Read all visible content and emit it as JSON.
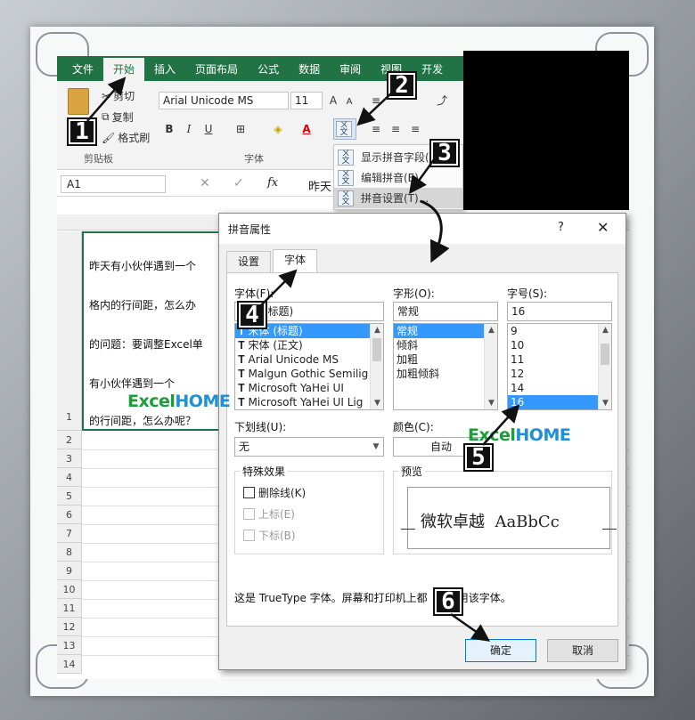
{
  "ribbon": {
    "tabs": [
      "文件",
      "开始",
      "插入",
      "页面布局",
      "公式",
      "数据",
      "审阅",
      "视图",
      "开发"
    ],
    "clipboard": {
      "cut": "剪切",
      "copy": "复制",
      "format_painter": "格式刷",
      "group": "剪贴板"
    },
    "font": {
      "name": "Arial Unicode MS",
      "size": "11",
      "group": "字体",
      "bold": "B",
      "italic": "I",
      "underline": "U",
      "grow": "A",
      "shrink": "A"
    }
  },
  "pinyin_menu": {
    "items": [
      "显示拼音字段(S)",
      "编辑拼音(E)",
      "拼音设置(T)..."
    ]
  },
  "formula_bar": {
    "name_box": "A1",
    "fx": "fx",
    "content": "昨天"
  },
  "sheet": {
    "rows": [
      "1",
      "2",
      "3",
      "4",
      "5",
      "6",
      "7",
      "8",
      "9",
      "10",
      "11",
      "12",
      "13",
      "14"
    ],
    "a1_lines": [
      "昨天有小伙伴遇到一个",
      "格内的行间距，怎么办",
      "的问题：要调整Excel单",
      "有小伙伴遇到一个",
      "的行间距，怎么办呢？"
    ]
  },
  "dialog": {
    "title": "拼音属性",
    "help": "?",
    "close": "✕",
    "tabs": [
      "设置",
      "字体"
    ],
    "font_label": "字体(F):",
    "font_value": "宋体 (标题)",
    "font_list": [
      "宋体 (标题)",
      "宋体 (正文)",
      "Arial Unicode MS",
      "Malgun Gothic Semilig",
      "Microsoft YaHei UI",
      "Microsoft YaHei UI Lig"
    ],
    "style_label": "字形(O):",
    "style_value": "常规",
    "style_list": [
      "常规",
      "倾斜",
      "加粗",
      "加粗倾斜"
    ],
    "size_label": "字号(S):",
    "size_value": "16",
    "size_list": [
      "9",
      "10",
      "11",
      "12",
      "14",
      "16"
    ],
    "underline_label": "下划线(U):",
    "underline_value": "无",
    "color_label": "颜色(C):",
    "color_value": "自动",
    "effects_label": "特殊效果",
    "strike": "删除线(K)",
    "superscript": "上标(E)",
    "subscript": "下标(B)",
    "preview_label": "预览",
    "preview_text": "微软卓越  AaBbCc",
    "note": "这是 TrueType 字体。屏幕和打印机上都",
    "note_tail": "用该字体。",
    "ok": "确定",
    "cancel": "取消"
  },
  "watermark": {
    "excel": "Excel",
    "home": "HOME"
  },
  "steps": [
    "1",
    "2",
    "3",
    "4",
    "5",
    "6"
  ],
  "colors": {
    "excel_green": "#217346",
    "select_blue": "#3399ff",
    "logo_green": "#1a9e3a",
    "logo_blue": "#1f8fd6"
  }
}
